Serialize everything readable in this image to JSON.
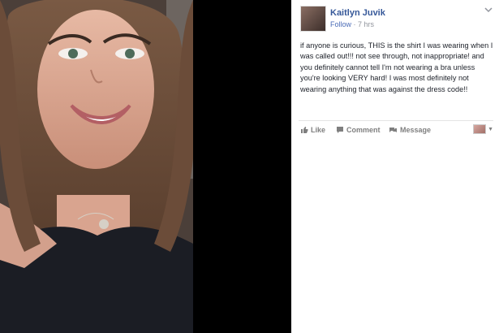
{
  "post": {
    "author": "Kaitlyn Juvik",
    "follow": "Follow",
    "separator": "·",
    "time": "7 hrs",
    "text": "if anyone is curious, THIS is the shirt I was wearing when I was called out!!! not see through, not inappropriate! and you definitely cannot tell I'm not wearing a bra unless you're looking VERY hard! I was most definitely not wearing anything that was against the dress code!!"
  },
  "actions": {
    "like": "Like",
    "comment": "Comment",
    "message": "Message"
  },
  "icons": {
    "like": "thumbs-up-icon",
    "comment": "comment-icon",
    "message": "message-icon",
    "menu": "chevron-down-icon"
  },
  "colors": {
    "link": "#365899",
    "secondary": "#90949c",
    "text": "#1d2129"
  }
}
